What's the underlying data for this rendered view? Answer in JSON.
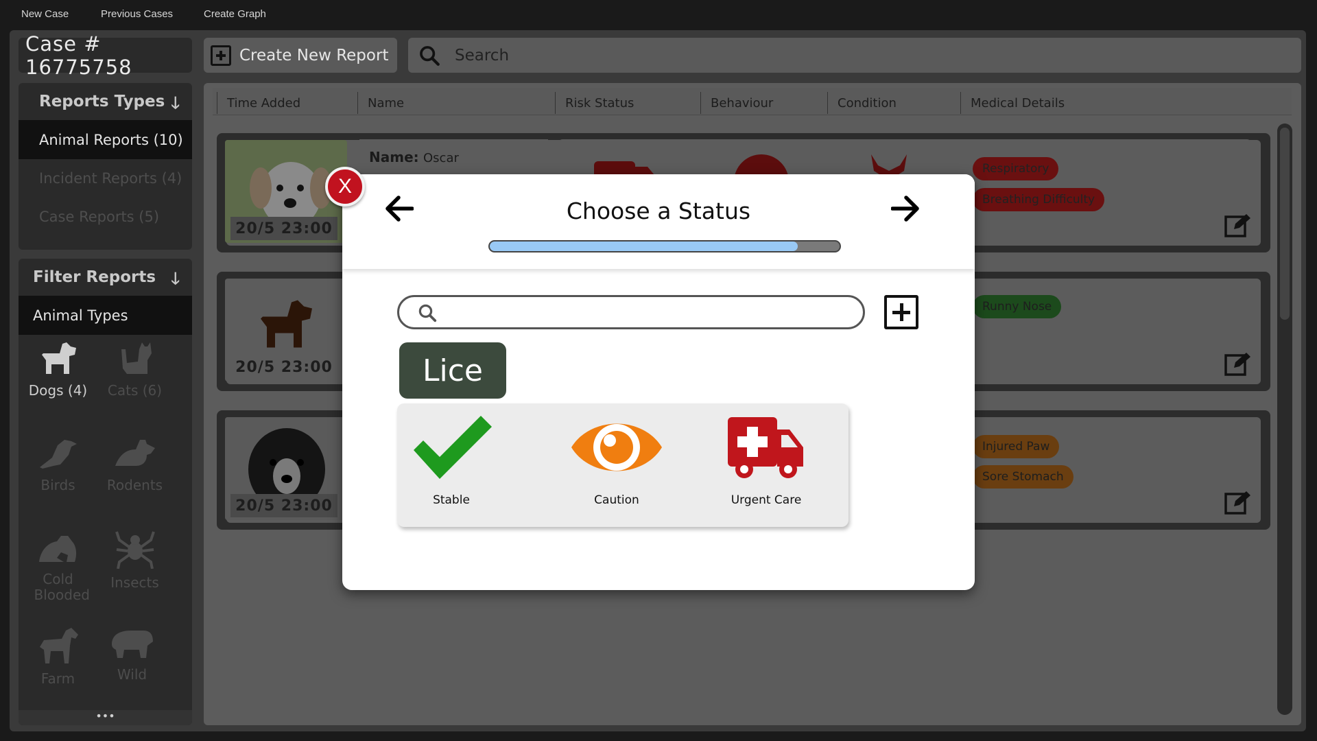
{
  "menu": {
    "items": [
      "New Case",
      "Previous Cases",
      "Create Graph"
    ]
  },
  "header": {
    "case_label": "Case # 16775758",
    "create_label": "Create New Report",
    "search_placeholder": "Search"
  },
  "sidebar": {
    "types_title": "Reports Types",
    "types": [
      {
        "label": "Animal Reports (10)"
      },
      {
        "label": "Incident Reports (4)"
      },
      {
        "label": "Case Reports (5)"
      }
    ],
    "filter_title": "Filter Reports",
    "animal_types_label": "Animal Types",
    "animals": [
      {
        "label": "Dogs",
        "count": "(4)",
        "icon": "dog-icon"
      },
      {
        "label": "Cats",
        "count": "(6)",
        "icon": "cat-icon"
      },
      {
        "label": "Birds",
        "icon": "bird-icon"
      },
      {
        "label": "Rodents",
        "icon": "rodent-icon"
      },
      {
        "label": "Cold Blooded",
        "icon": "frog-icon"
      },
      {
        "label": "Insects",
        "icon": "spider-icon"
      },
      {
        "label": "Farm",
        "icon": "horse-icon"
      },
      {
        "label": "Wild",
        "icon": "hippo-icon"
      }
    ],
    "more": "•••"
  },
  "table": {
    "columns": [
      "Time Added",
      "Name",
      "Risk Status",
      "Behaviour",
      "Condition",
      "Medical Details"
    ]
  },
  "reports": [
    {
      "time": "20/5 23:00",
      "name_label": "Name:",
      "name": "Oscar",
      "tags": [
        {
          "label": "Respiratory",
          "kind": "red"
        },
        {
          "label": "Breathing Difficulty",
          "kind": "red"
        }
      ]
    },
    {
      "time": "20/5 23:00",
      "tags": [
        {
          "label": "Runny Nose",
          "kind": "green"
        }
      ]
    },
    {
      "time": "20/5 23:00",
      "tags": [
        {
          "label": "Injured Paw",
          "kind": "orange"
        },
        {
          "label": "Sore Stomach",
          "kind": "orange"
        }
      ]
    }
  ],
  "modal": {
    "title": "Choose a Status",
    "close_label": "X",
    "progress": 0.88,
    "selected_chip": "Lice",
    "options": [
      {
        "label": "Stable",
        "icon": "checkmark-icon",
        "color": "#1e9a1e"
      },
      {
        "label": "Caution",
        "icon": "eye-icon",
        "color": "#f07e10"
      },
      {
        "label": "Urgent Care",
        "icon": "ambulance-icon",
        "color": "#c0161c"
      }
    ]
  },
  "colors": {
    "stable": "#1e9a1e",
    "caution": "#f07e10",
    "urgent": "#c0161c",
    "chip": "#3c4a3d",
    "progress_fill": "#99c9f5"
  }
}
